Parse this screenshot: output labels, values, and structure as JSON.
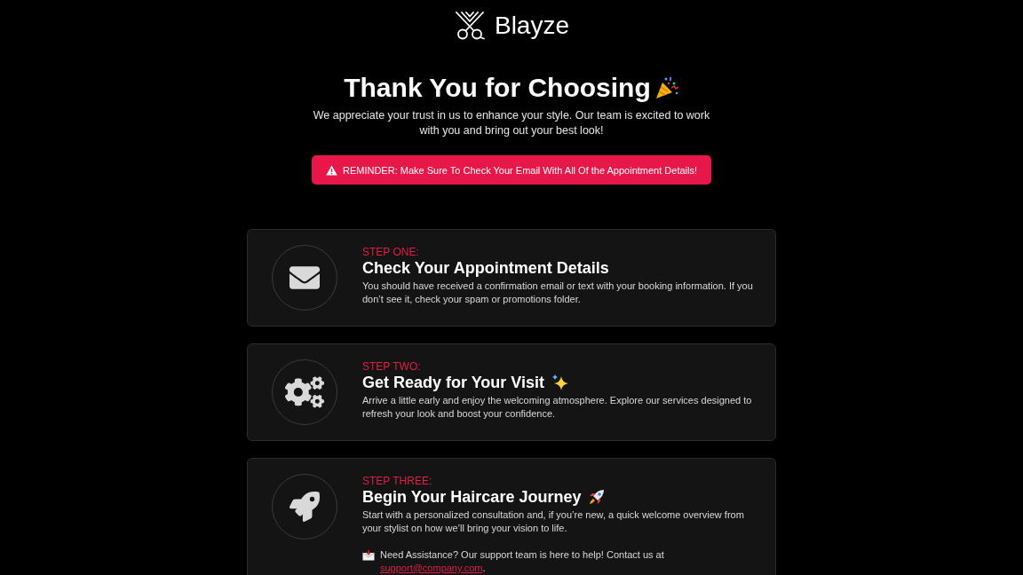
{
  "brand": {
    "name": "Blayze"
  },
  "hero": {
    "title": "Thank You for Choosing",
    "subtitle": "We appreciate your trust in us to enhance your style. Our team is excited to work with you and bring out your best look!",
    "reminder": "REMINDER: Make Sure To Check Your Email With All Of the Appointment Details!"
  },
  "steps": [
    {
      "kind": "envelope",
      "label": "STEP ONE:",
      "title": "Check Your Appointment Details",
      "description": "You should have received a confirmation email or text with your booking information. If you don’t see it, check your spam or promotions folder."
    },
    {
      "kind": "gears",
      "label": "STEP TWO:",
      "title": "Get Ready for Your Visit",
      "description": "Arrive a little early and enjoy the welcoming atmosphere. Explore our services designed to refresh your look and boost your confidence."
    },
    {
      "kind": "rocket",
      "label": "STEP THREE:",
      "title": "Begin Your Haircare Journey",
      "description": "Start with a personalized consultation and, if you’re new, a quick welcome overview from your stylist on how we’ll bring your vision to life.",
      "support": {
        "text": "Need Assistance? Our support team is here to help! Contact us at",
        "link": "support@company.com",
        "after": "."
      }
    }
  ]
}
